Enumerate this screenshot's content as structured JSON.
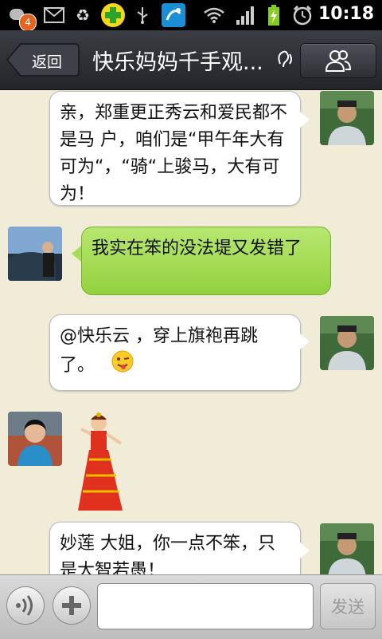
{
  "status_bar": {
    "notification_badge": "4",
    "time": "10:18",
    "icons": [
      "notification-icon",
      "mail-icon",
      "recycle-icon",
      "plus-app-icon",
      "usb-icon",
      "app-icon",
      "wifi-icon",
      "signal-icon",
      "battery-charging-icon",
      "alarm-icon"
    ]
  },
  "header": {
    "back_label": "返回",
    "title": "快乐妈妈千手观...",
    "contacts_icon": "group-contacts-icon"
  },
  "messages": [
    {
      "side": "right",
      "text": "亲，郑重更正秀云和爱民都不是马 户，咱们是“甲午年大有可为“，“骑“上骏马，大有可为！"
    },
    {
      "side": "left",
      "text": "我实在笨的没法堤又发错了"
    },
    {
      "side": "right",
      "text": "@快乐云 ，穿上旗袍再跳了。",
      "emoji": "winking-face-tongue"
    },
    {
      "side": "left",
      "sticker": "dancing-girl-sticker"
    },
    {
      "side": "right",
      "text": "妙莲 大姐，你一点不笨，只是大智若愚！"
    }
  ],
  "input_bar": {
    "voice_icon": "voice-icon",
    "add_icon": "plus-icon",
    "message_placeholder": "",
    "send_label": "发送"
  },
  "colors": {
    "chat_background": "#f1ecd8",
    "incoming_bubble": "#a6dd56",
    "outgoing_bubble": "#ffffff",
    "title_bar": "#2c2e33"
  }
}
